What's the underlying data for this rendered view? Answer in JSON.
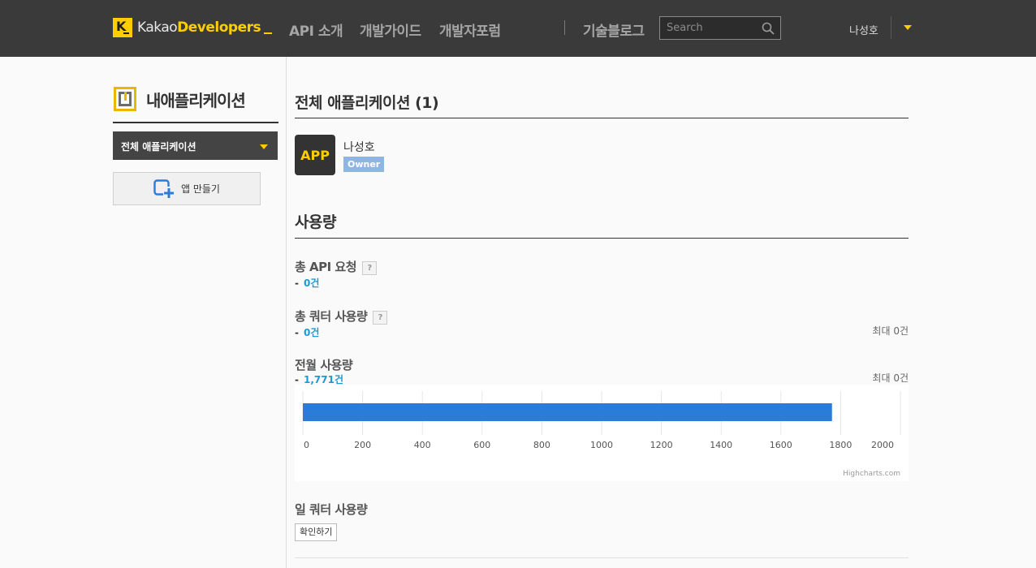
{
  "header": {
    "logo_left": "Kakao",
    "logo_right": "Developers",
    "nav": [
      "API 소개",
      "개발가이드",
      "개발자포럼",
      "기술블로그"
    ],
    "search_placeholder": "Search",
    "user_name": "나성호",
    "accent_color": "#ffcd00"
  },
  "sidebar": {
    "title": "내애플리케이션",
    "select_label": "전체 애플리케이션",
    "make_app_label": "앱 만들기"
  },
  "main": {
    "all_apps_title": "전체 애플리케이션 (1)",
    "app": {
      "icon_text": "APP",
      "name": "나성호",
      "role": "Owner"
    },
    "usage_title": "사용량",
    "metrics": [
      {
        "label": "총 API 요청",
        "help": "?",
        "dash": "-",
        "value": "0건",
        "max": ""
      },
      {
        "label": "총 쿼터 사용량",
        "help": "?",
        "dash": "-",
        "value": "0건",
        "max": "최대 0건"
      },
      {
        "label": "전월 사용량",
        "help": "",
        "dash": "-",
        "value": "1,771건",
        "max": "최대 0건"
      }
    ],
    "daily_quota_label": "일 쿼터 사용량",
    "check_button": "확인하기",
    "chart_credits": "Highcharts.com"
  },
  "chart_data": {
    "type": "bar",
    "orientation": "horizontal",
    "categories": [
      ""
    ],
    "values": [
      1771
    ],
    "xlim": [
      0,
      2000
    ],
    "ticks": [
      0,
      200,
      400,
      600,
      800,
      1000,
      1200,
      1400,
      1600,
      1800,
      2000
    ],
    "bar_color": "#2b7bd8",
    "grid": true,
    "title": "",
    "xlabel": "",
    "ylabel": ""
  }
}
